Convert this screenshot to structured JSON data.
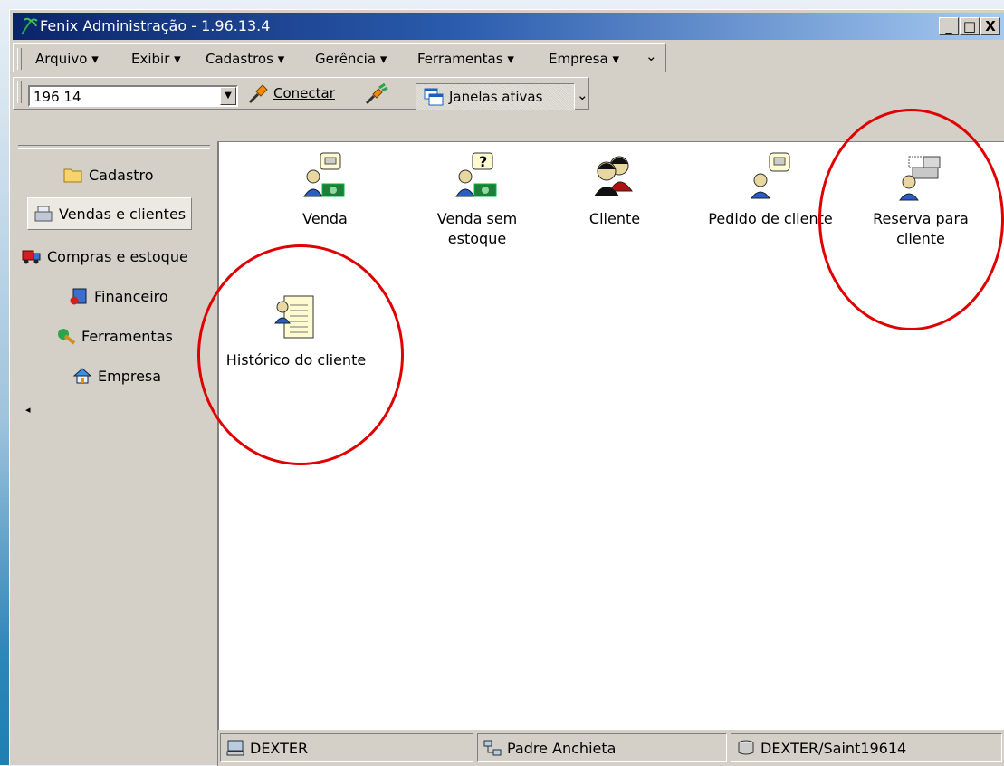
{
  "window": {
    "title": "Fenix Administração - 1.96.13.4",
    "buttons": {
      "minimize": "_",
      "maximize": "□",
      "close": "X"
    }
  },
  "menubar": {
    "items": [
      "Arquivo",
      "Exibir",
      "Cadastros",
      "Gerência",
      "Ferramentas",
      "Empresa"
    ],
    "dropdown_marker": "▾",
    "chevron": "⌄"
  },
  "toolbar": {
    "connection": {
      "value": "196 14"
    },
    "connect_label": "Conectar",
    "windows_label": "Janelas ativas"
  },
  "sidebar": {
    "items": [
      {
        "label": "Cadastro",
        "icon": "folder-icon"
      },
      {
        "label": "Vendas e clientes",
        "icon": "cash-register-icon",
        "active": true
      },
      {
        "label": "Compras e estoque",
        "icon": "truck-icon"
      },
      {
        "label": "Financeiro",
        "icon": "finance-icon"
      },
      {
        "label": "Ferramentas",
        "icon": "tools-icon"
      },
      {
        "label": "Empresa",
        "icon": "home-icon"
      }
    ],
    "scroll_marker": "◂"
  },
  "tiles": [
    {
      "label": "Venda",
      "icon": "sale-icon"
    },
    {
      "label": "Venda sem estoque",
      "icon": "sale-no-stock-icon"
    },
    {
      "label": "Cliente",
      "icon": "client-icon"
    },
    {
      "label": "Pedido de cliente",
      "icon": "client-order-icon"
    },
    {
      "label": "Reserva para cliente",
      "icon": "client-reservation-icon"
    },
    {
      "label": "Histórico do cliente",
      "icon": "client-history-icon"
    }
  ],
  "statusbar": {
    "computer": "DEXTER",
    "branch": "Padre Anchieta",
    "database": "DEXTER/Saint19614"
  },
  "colors": {
    "titlebar_start": "#0a246a",
    "titlebar_end": "#a6caf0",
    "annotation_circle": "#e00000",
    "face": "#d4d0c8"
  }
}
